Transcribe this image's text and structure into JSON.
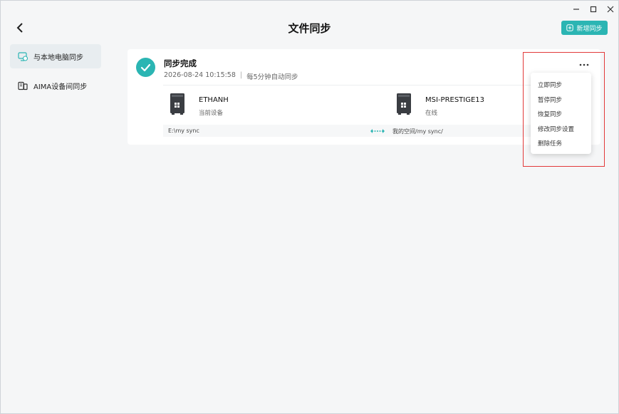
{
  "window": {
    "title": "文件同步",
    "controls": [
      "minimize-icon",
      "maximize-icon",
      "close-icon"
    ]
  },
  "header": {
    "back_icon": "chevron-left-icon",
    "new_button_label": "新增同步"
  },
  "sidebar": {
    "items": [
      {
        "label": "与本地电脑同步",
        "icon": "local-sync-icon",
        "active": true
      },
      {
        "label": "AIMA设备间同步",
        "icon": "device-sync-icon",
        "active": false
      }
    ]
  },
  "task": {
    "status": "同步完成",
    "timestamp": "2026-08-24 10:15:58",
    "interval": "每5分钟自动同步",
    "local": {
      "name": "ETHANH",
      "sub": "当前设备",
      "path": "E:\\my sync"
    },
    "remote": {
      "name": "MSI-PRESTIGE13",
      "sub": "在线",
      "path": "我的空间/my sync/"
    }
  },
  "menu": {
    "items": [
      "立即同步",
      "暂停同步",
      "恢复同步",
      "修改同步设置",
      "删除任务"
    ]
  },
  "colors": {
    "accent": "#2bb5b3",
    "highlight": "#e23a3a"
  }
}
